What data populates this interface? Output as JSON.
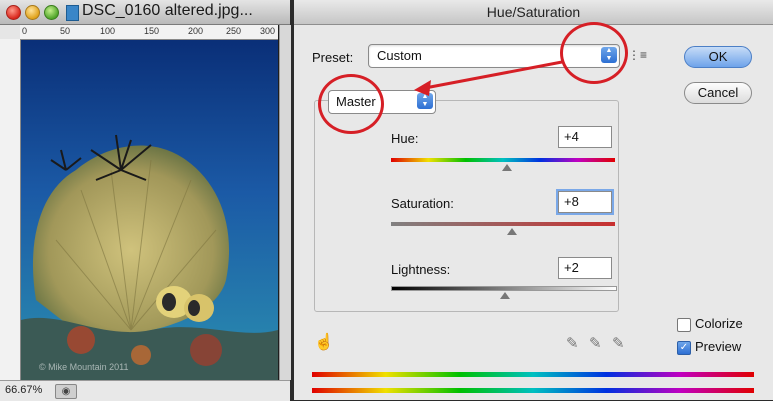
{
  "document_window": {
    "title": "DSC_0160 altered.jpg...",
    "ruler_ticks": [
      "0",
      "50",
      "100",
      "150",
      "200",
      "250",
      "300"
    ],
    "zoom_level": "66.67%",
    "watermark": "© Mike Mountain 2011"
  },
  "dialog": {
    "title": "Hue/Saturation",
    "preset_label": "Preset:",
    "preset_value": "Custom",
    "channel_value": "Master",
    "hue": {
      "label": "Hue:",
      "value": "+4",
      "thumb_fraction": 0.52
    },
    "saturation": {
      "label": "Saturation:",
      "value": "+8",
      "thumb_fraction": 0.54
    },
    "lightness": {
      "label": "Lightness:",
      "value": "+2",
      "thumb_fraction": 0.51
    },
    "ok_label": "OK",
    "cancel_label": "Cancel",
    "colorize_label": "Colorize",
    "colorize_checked": false,
    "preview_label": "Preview",
    "preview_checked": true
  },
  "annotation": {
    "color": "#d61f26"
  }
}
